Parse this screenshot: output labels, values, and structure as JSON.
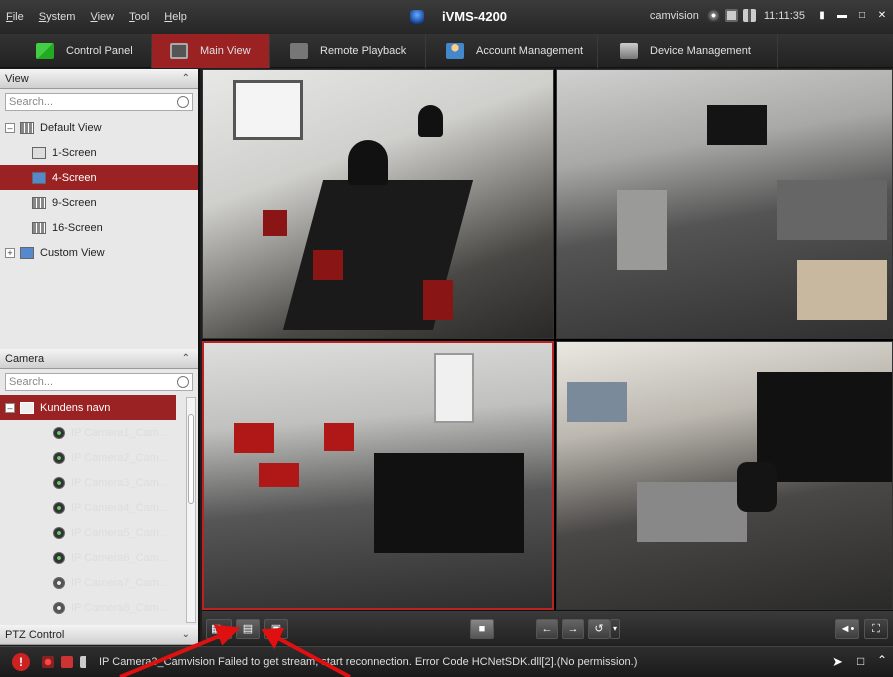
{
  "menu": [
    "File",
    "System",
    "View",
    "Tool",
    "Help"
  ],
  "app_title": "iVMS-4200",
  "user": "camvision",
  "time": "11:11:35",
  "nav_tabs": [
    {
      "label": "Control Panel",
      "active": false
    },
    {
      "label": "Main View",
      "active": true
    },
    {
      "label": "Remote Playback",
      "active": false
    },
    {
      "label": "Account Management",
      "active": false
    },
    {
      "label": "Device Management",
      "active": false
    }
  ],
  "view_panel": {
    "title": "View",
    "search_placeholder": "Search...",
    "default_view": "Default View",
    "items": [
      "1-Screen",
      "4-Screen",
      "9-Screen",
      "16-Screen"
    ],
    "selected": "4-Screen",
    "custom_view": "Custom View"
  },
  "camera_panel": {
    "title": "Camera",
    "search_placeholder": "Search...",
    "group": "Kundens navn",
    "cameras": [
      "IP Camera1_Cam...",
      "IP Camera2_Cam...",
      "IP Camera3_Cam...",
      "IP Camera4_Cam...",
      "IP Camera5_Cam...",
      "IP Camera6_Cam...",
      "IP Camera7_Cam...",
      "IP Camera8_Cam..."
    ]
  },
  "ptz": {
    "title": "PTZ Control"
  },
  "status_message": "IP Camera3_Camvision Failed to get stream, start reconnection. Error Code HCNetSDK.dll[2].(No permission.)",
  "colors": {
    "accent": "#9a2222",
    "arrow": "#e01010"
  }
}
